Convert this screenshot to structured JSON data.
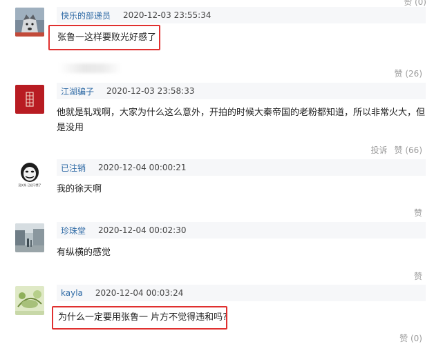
{
  "top_actions": {
    "label": "赞 (0)"
  },
  "comments": [
    {
      "user": "快乐的部递员",
      "time": "2020-12-03 23:55:34",
      "text": "张鲁一这样要败光好感了",
      "actions": [
        {
          "label": "赞 (26)"
        }
      ]
    },
    {
      "user": "江湖骗子",
      "time": "2020-12-03 23:58:33",
      "text": "他就是轧戏啊，大家为什么这么意外，开拍的时候大秦帝国的老粉都知道，所以非常火大，但是没用",
      "actions": [
        {
          "label": "投诉"
        },
        {
          "label": "赞 (66)"
        }
      ]
    },
    {
      "user": "已注销",
      "time": "2020-12-04 00:00:21",
      "text": "我的徐天啊",
      "avatar_caption": "没关系 已经习惯了",
      "actions": [
        {
          "label": "赞"
        }
      ]
    },
    {
      "user": "珍珠堂",
      "time": "2020-12-04 00:02:30",
      "text": "有纵横的感觉",
      "actions": [
        {
          "label": "赞"
        }
      ]
    },
    {
      "user": "kayla",
      "time": "2020-12-04 00:03:24",
      "text": "为什么一定要用张鲁一 片方不觉得违和吗?",
      "actions": [
        {
          "label": "赞 (0)"
        }
      ]
    }
  ],
  "colors": {
    "username": "#2e6aa5",
    "highlight": "#e0302f",
    "muted": "#9a9a9a",
    "header_bg": "#f6f7f9"
  }
}
